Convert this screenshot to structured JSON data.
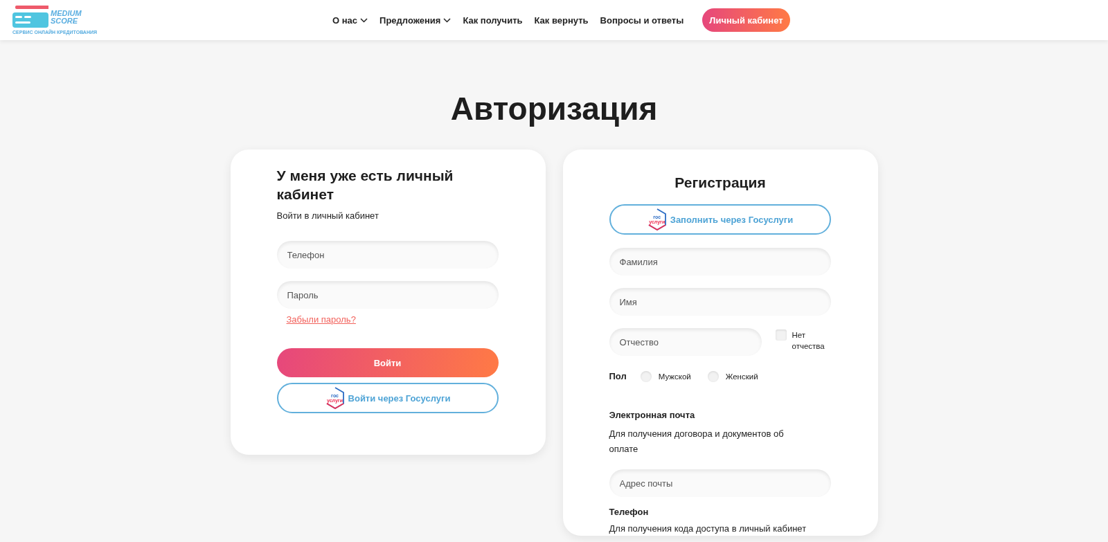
{
  "header": {
    "logo": {
      "name": "MEDIUM SCORE",
      "tagline": "СЕРВИС ОНЛАЙН КРЕДИТОВАНИЯ"
    },
    "nav": [
      {
        "label": "О нас",
        "dropdown": true
      },
      {
        "label": "Предложения",
        "dropdown": true
      },
      {
        "label": "Как получить",
        "dropdown": false
      },
      {
        "label": "Как вернуть",
        "dropdown": false
      },
      {
        "label": "Вопросы и ответы",
        "dropdown": false
      }
    ],
    "account_button": "Личный кабинет"
  },
  "title": "Авторизация",
  "login": {
    "heading": "У меня уже есть личный кабинет",
    "subtitle": "Войти в личный кабинет",
    "fields": [
      {
        "placeholder": "Телефон"
      },
      {
        "placeholder": "Пароль"
      }
    ],
    "forgot_link": "Забыли пароль?",
    "submit": "Войти",
    "gosuslugi_button": {
      "label": "Войти через Госуслуги",
      "logo": [
        "гос",
        "услуги"
      ]
    }
  },
  "registration": {
    "heading": "Регистрация",
    "gosuslugi_button": {
      "label": "Заполнить через Госуслуги",
      "logo": [
        "гос",
        "услуги"
      ]
    },
    "fields": [
      {
        "placeholder": "Фамилия"
      },
      {
        "placeholder": "Имя"
      }
    ],
    "patronymic": {
      "placeholder": "Отчество",
      "no_patronymic": {
        "label": "Нет отчества",
        "checked": false
      }
    },
    "gender": {
      "label": "Пол",
      "options": [
        {
          "label": "Мужской",
          "selected": false
        },
        {
          "label": "Женский",
          "selected": false
        }
      ]
    },
    "email": {
      "label": "Электронная почта",
      "hint": "Для получения договора и документов об оплате",
      "placeholder": "Адрес почты"
    },
    "phone": {
      "label": "Телефон",
      "hint": "Для получения кода доступа в личный кабинет"
    }
  }
}
